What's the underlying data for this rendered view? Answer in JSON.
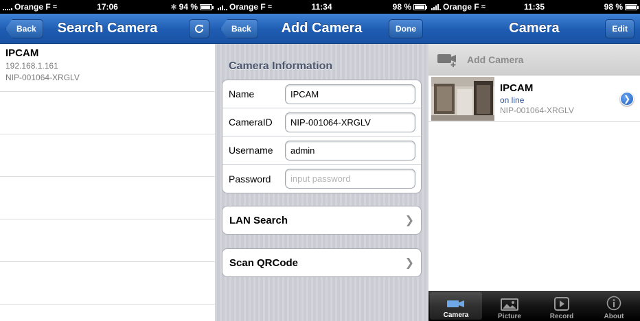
{
  "screen1": {
    "status": {
      "carrier": "Orange F",
      "time": "17:06",
      "battery": "94 %"
    },
    "nav": {
      "back_label": "Back",
      "title": "Search Camera",
      "refresh_icon": "refresh-icon"
    },
    "results": [
      {
        "name": "IPCAM",
        "ip": "192.168.1.161",
        "uid": "NIP-001064-XRGLV"
      }
    ]
  },
  "screen2": {
    "status": {
      "carrier": "Orange F",
      "time": "11:34",
      "battery": "98 %"
    },
    "nav": {
      "back_label": "Back",
      "title": "Add Camera",
      "done_label": "Done"
    },
    "section_title": "Camera Information",
    "fields": [
      {
        "label": "Name",
        "value": "IPCAM",
        "placeholder": ""
      },
      {
        "label": "CameraID",
        "value": "NIP-001064-XRGLV",
        "placeholder": ""
      },
      {
        "label": "Username",
        "value": "admin",
        "placeholder": ""
      },
      {
        "label": "Password",
        "value": "",
        "placeholder": "input password"
      }
    ],
    "lan_search_label": "LAN Search",
    "scan_qr_label": "Scan QRCode"
  },
  "screen3": {
    "status": {
      "carrier": "Orange F",
      "time": "11:35",
      "battery": "98 %"
    },
    "nav": {
      "title": "Camera",
      "edit_label": "Edit"
    },
    "add_camera_label": "Add Camera",
    "cameras": [
      {
        "name": "IPCAM",
        "status": "on line",
        "uid": "NIP-001064-XRGLV"
      }
    ],
    "tabs": [
      {
        "label": "Camera",
        "icon": "camera-icon",
        "active": true
      },
      {
        "label": "Picture",
        "icon": "picture-icon",
        "active": false
      },
      {
        "label": "Record",
        "icon": "record-icon",
        "active": false
      },
      {
        "label": "About",
        "icon": "info-icon",
        "active": false
      }
    ]
  },
  "colors": {
    "nav_blue": "#1e5cb2",
    "online_blue": "#2a56a8",
    "section_text": "#4c566c"
  }
}
